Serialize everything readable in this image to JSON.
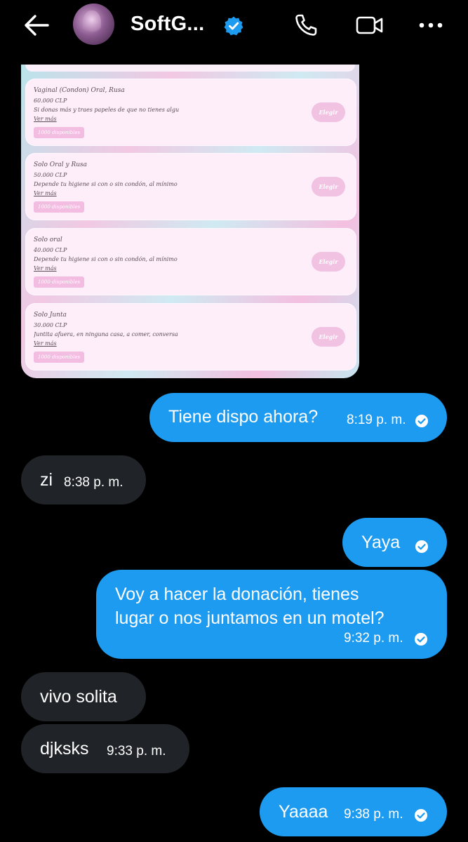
{
  "header": {
    "title": "SoftG...",
    "icons": [
      "back-arrow-icon",
      "avatar",
      "verified-badge-icon",
      "phone-icon",
      "video-icon",
      "more-icon"
    ]
  },
  "shared_image": {
    "items": [
      {
        "name": "Vaginal (Condon) Oral, Rusa",
        "price": "60.000 CLP",
        "desc": "Si donas más y traes papeles de que no tienes algu",
        "more": "Ver más",
        "badge": "1000 disponibles",
        "button": "Elegir"
      },
      {
        "name": "Solo Oral y Rusa",
        "price": "50.000 CLP",
        "desc": "Depende tu higiene si con o sin condón, al mínimo",
        "more": "Ver más",
        "badge": "1000 disponibles",
        "button": "Elegir"
      },
      {
        "name": "Solo oral",
        "price": "40.000 CLP",
        "desc": "Depende tu higiene si con o sin condón, al mínimo",
        "more": "Ver más",
        "badge": "1000 disponibles",
        "button": "Elegir"
      },
      {
        "name": "Solo Junta",
        "price": "30.000 CLP",
        "desc": "Juntita afuera, en ninguna casa, a comer, conversa",
        "more": "Ver más",
        "badge": "1000 disponibles",
        "button": "Elegir"
      }
    ]
  },
  "messages": [
    {
      "text": "Tiene dispo ahora?",
      "time": "8:19 p. m."
    },
    {
      "text": "zi",
      "time": "8:38 p. m."
    },
    {
      "text": "Yaya",
      "time": ""
    },
    {
      "text_line1": "Voy a hacer la donación, tienes",
      "text_line2": "lugar o nos juntamos en un motel?",
      "time": "9:32 p. m."
    },
    {
      "text": "vivo solita",
      "time": ""
    },
    {
      "text": "djksks",
      "time": "9:33 p. m."
    },
    {
      "text": "Yaaaa",
      "time": "9:38 p. m."
    }
  ],
  "colors": {
    "outgoing": "#1d9bf0",
    "incoming": "#202327",
    "background": "#000000"
  }
}
